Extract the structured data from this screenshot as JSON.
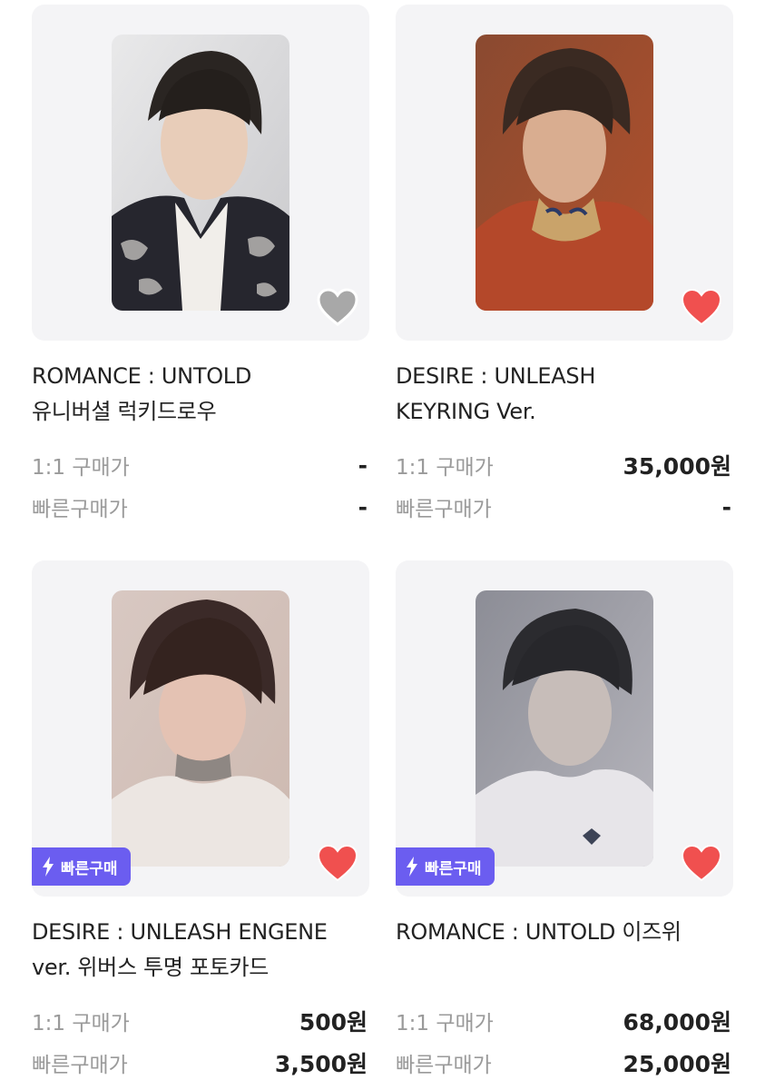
{
  "colors": {
    "card_bg": "#f4f4f6",
    "heart_active": "#f0504f",
    "heart_inactive": "#a8a8a8",
    "badge_bg": "#6b5df0",
    "label_gray": "#9a9a9a"
  },
  "products": [
    {
      "title_line1": "ROMANCE : UNTOLD",
      "title_line2": "유니버셜 럭키드로우",
      "liked": false,
      "heart_icon": "heart-outline-icon",
      "fast_badge": "",
      "label_1to1": "1:1 구매가",
      "price_1to1": "-",
      "label_fast": "빠른구매가",
      "price_fast": "-"
    },
    {
      "title_line1": "DESIRE : UNLEASH",
      "title_line2": "KEYRING Ver.",
      "liked": true,
      "heart_icon": "heart-filled-icon",
      "fast_badge": "",
      "label_1to1": "1:1 구매가",
      "price_1to1": "35,000원",
      "label_fast": "빠른구매가",
      "price_fast": "-"
    },
    {
      "title_line1": "DESIRE : UNLEASH ENGENE",
      "title_line2": "ver. 위버스 투명 포토카드",
      "liked": true,
      "heart_icon": "heart-filled-icon",
      "fast_badge": "빠른구매",
      "label_1to1": "1:1 구매가",
      "price_1to1": "500원",
      "label_fast": "빠른구매가",
      "price_fast": "3,500원"
    },
    {
      "title_line1": "ROMANCE : UNTOLD 이즈위",
      "title_line2": "",
      "liked": true,
      "heart_icon": "heart-filled-icon",
      "fast_badge": "빠른구매",
      "label_1to1": "1:1 구매가",
      "price_1to1": "68,000원",
      "label_fast": "빠른구매가",
      "price_fast": "25,000원"
    }
  ]
}
